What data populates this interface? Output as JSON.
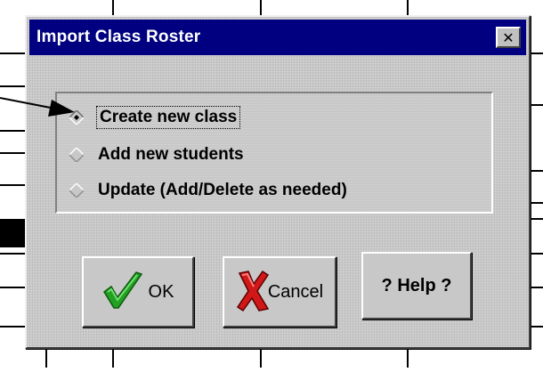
{
  "dialog": {
    "title": "Import Class Roster",
    "close_glyph": "✕"
  },
  "options": [
    {
      "label": "Create new class",
      "selected": true
    },
    {
      "label": "Add new students",
      "selected": false
    },
    {
      "label": "Update (Add/Delete as needed)",
      "selected": false
    }
  ],
  "buttons": {
    "ok_label": "OK",
    "cancel_label": "Cancel",
    "help_label": "? Help ?"
  },
  "icons": {
    "ok": "checkmark-icon",
    "cancel": "x-mark-icon",
    "close": "close-icon",
    "annotation": "arrow-icon"
  },
  "colors": {
    "titlebar": "#000080",
    "checkmark": "#22a022",
    "x_mark": "#d01818"
  }
}
